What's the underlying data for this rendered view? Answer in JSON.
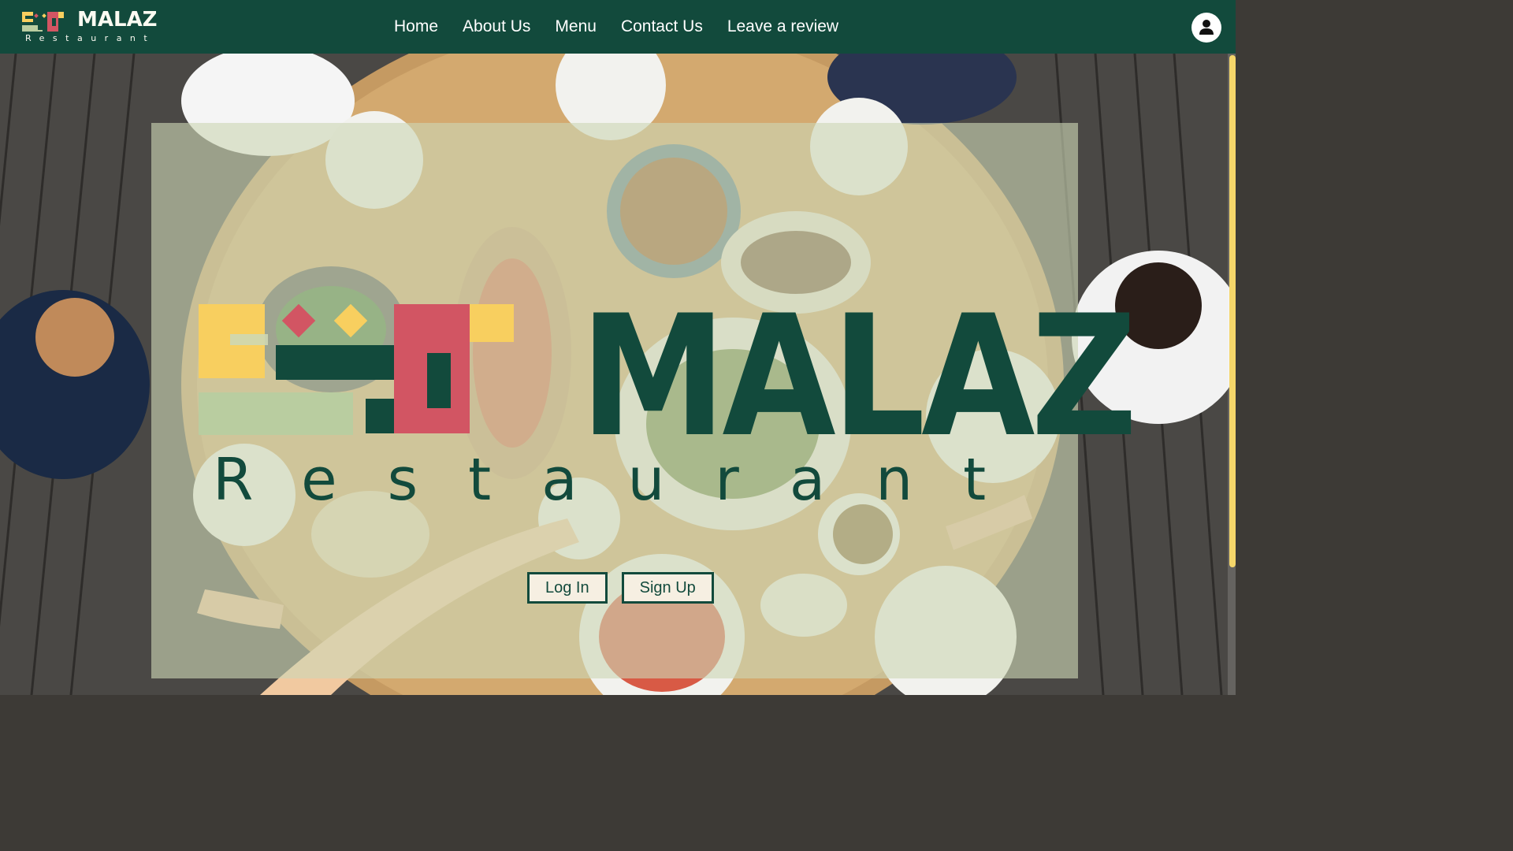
{
  "colors": {
    "brand_green": "#124a3c",
    "brand_yellow": "#f8cf5f",
    "brand_red": "#d25563",
    "brand_sage": "#b9cda0",
    "cream": "#f6efe2"
  },
  "header": {
    "logo": {
      "word": "MALAZ",
      "sub": "Restaurant"
    },
    "nav": [
      {
        "label": "Home"
      },
      {
        "label": "About Us"
      },
      {
        "label": "Menu"
      },
      {
        "label": "Contact Us"
      },
      {
        "label": "Leave a review"
      }
    ],
    "account_icon": "user-icon"
  },
  "hero": {
    "background_image": "overhead-dinner-table-photo",
    "logo": {
      "word": "MALAZ",
      "sub": "Restaurant"
    },
    "buttons": {
      "login": "Log In",
      "signup": "Sign Up"
    }
  }
}
